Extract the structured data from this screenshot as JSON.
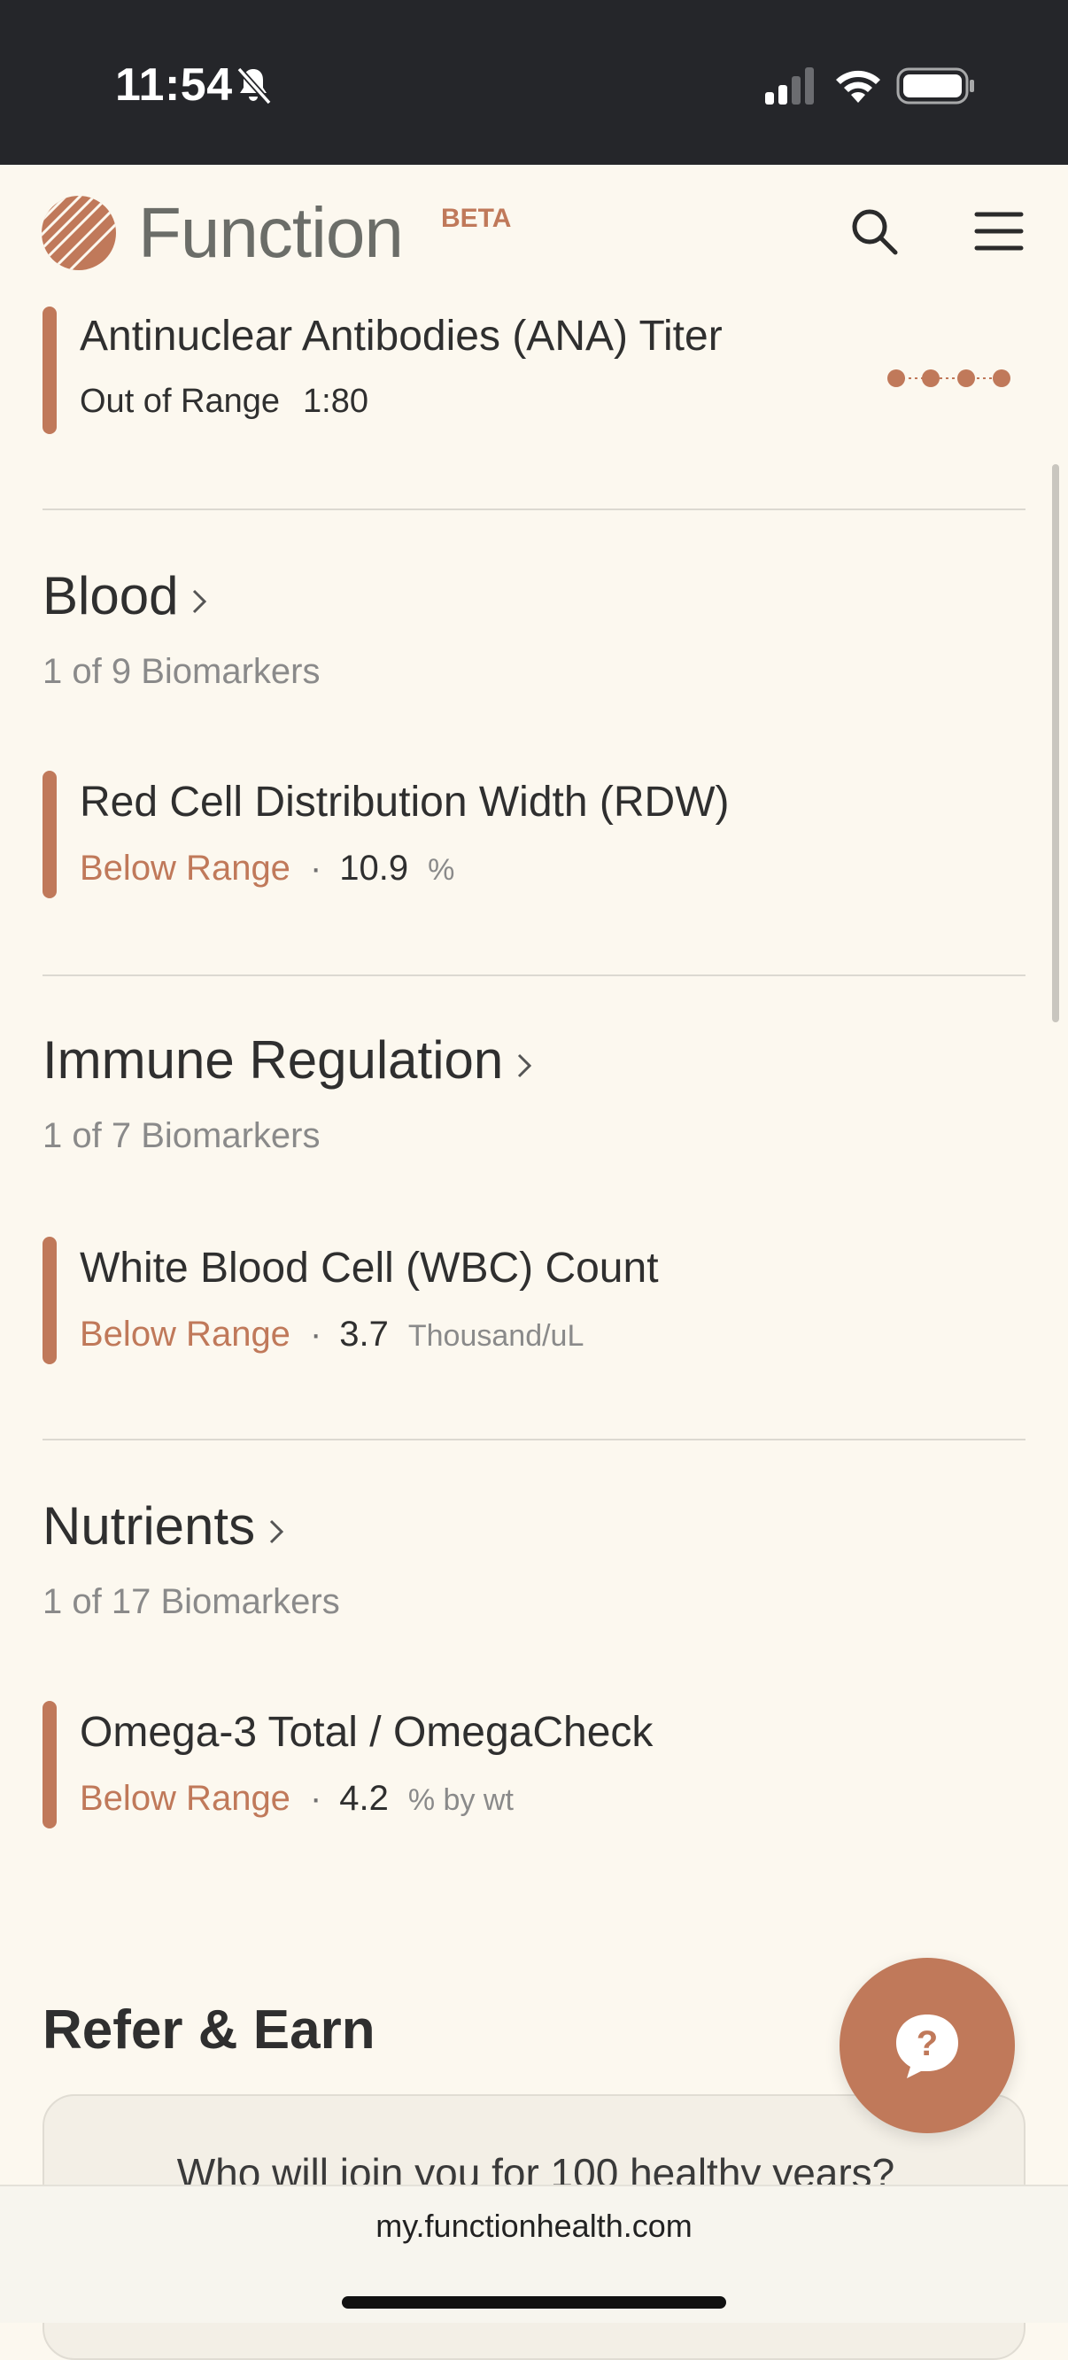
{
  "status_bar": {
    "time": "11:54"
  },
  "header": {
    "brand": "Function",
    "badge": "BETA"
  },
  "biomarkers_top": {
    "name": "Antinuclear Antibodies (ANA) Titer",
    "status": "Out of Range",
    "value": "1:80"
  },
  "sections": [
    {
      "title": "Blood",
      "count": "1 of 9 Biomarkers",
      "marker": {
        "name": "Red Cell Distribution Width (RDW)",
        "status": "Below Range",
        "value": "10.9",
        "unit": "%"
      }
    },
    {
      "title": "Immune Regulation",
      "count": "1 of 7 Biomarkers",
      "marker": {
        "name": "White Blood Cell (WBC) Count",
        "status": "Below Range",
        "value": "3.7",
        "unit": "Thousand/uL"
      }
    },
    {
      "title": "Nutrients",
      "count": "1 of 17 Biomarkers",
      "marker": {
        "name": "Omega-3 Total / OmegaCheck",
        "status": "Below Range",
        "value": "4.2",
        "unit": "% by wt"
      }
    }
  ],
  "refer": {
    "title": "Refer & Earn",
    "card_text": "Who will join you for 100 healthy years?"
  },
  "browser": {
    "url": "my.functionhealth.com"
  },
  "separator": "·",
  "colors": {
    "accent": "#c0795a",
    "background": "#fcf8ef",
    "status_bar": "#25262a"
  },
  "icons": [
    "bell-slash-icon",
    "signal-icon",
    "wifi-icon",
    "battery-icon",
    "search-icon",
    "menu-icon",
    "chevron-right-icon",
    "help-icon"
  ]
}
